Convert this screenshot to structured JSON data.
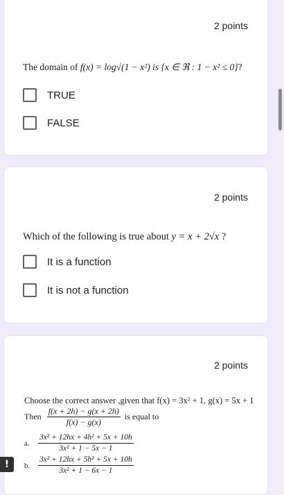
{
  "colors": {
    "page_background": "#f0ebf8",
    "card_background": "#ffffff",
    "text": "#202124",
    "checkbox_border": "#5f6368"
  },
  "questions": [
    {
      "points": "2 points",
      "prompt_prefix": "The domain of ",
      "prompt_math": "f(x) = log√(1 − x²) is {x ∈ ℜ : 1 − x² ≤ 0}",
      "prompt_suffix": "?",
      "options": [
        "TRUE",
        "FALSE"
      ]
    },
    {
      "points": "2 points",
      "prompt_prefix": "Which of the following is true about ",
      "prompt_math": "y = x + 2√x",
      "prompt_suffix": " ?",
      "options": [
        "It is a function",
        "It is not a function"
      ]
    },
    {
      "points": "2 points",
      "prompt": "Choose the correct answer ,given that f(x) = 3x² + 1, g(x) = 5x + 1",
      "then_label": "Then",
      "then_num": "f(x + 2h) − g(x + 2h)",
      "then_den": "f(x) − g(x)",
      "then_suffix": "is equal to",
      "options": [
        {
          "letter": "a.",
          "num": "3x² + 12hx + 4h² + 5x + 10h",
          "den": "3x² + 1 − 5x − 1"
        },
        {
          "letter": "b.",
          "num": "3x² + 12hx + 5h² + 5x + 10h",
          "den": "3x² + 1 − 6x − 1"
        }
      ]
    }
  ],
  "icons": {
    "checkbox": "empty-square",
    "warning": "exclamation-mark"
  },
  "warning_symbol": "!"
}
